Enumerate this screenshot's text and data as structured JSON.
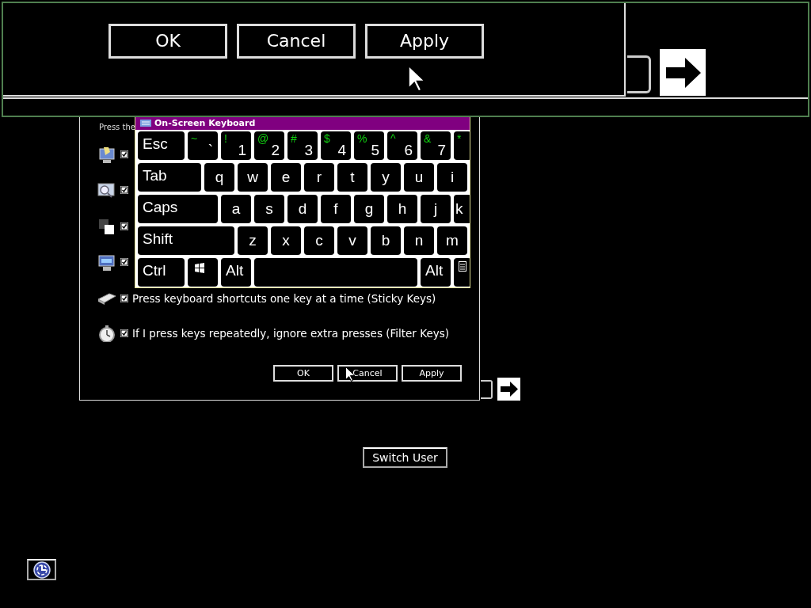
{
  "dialog": {
    "intro": "Press the",
    "options": [
      {
        "checked": true
      },
      {
        "checked": true
      },
      {
        "checked": true
      },
      {
        "checked": true
      },
      {
        "checked": true,
        "label": "Press keyboard shortcuts one key at a time (Sticky Keys)"
      },
      {
        "checked": true,
        "label": "If I press keys repeatedly, ignore extra presses (Filter Keys)"
      }
    ],
    "buttons": [
      "OK",
      "Cancel",
      "Apply"
    ]
  },
  "keyboard": {
    "title": "On-Screen Keyboard",
    "key_rows": [
      {
        "keys": [
          {
            "kind": "esc",
            "label": "Esc"
          },
          {
            "kind": "char",
            "shift": "~",
            "label": "`"
          },
          {
            "kind": "char",
            "shift": "!",
            "label": "1"
          },
          {
            "kind": "char",
            "shift": "@",
            "label": "2"
          },
          {
            "kind": "char",
            "shift": "#",
            "label": "3"
          },
          {
            "kind": "char",
            "shift": "$",
            "label": "4"
          },
          {
            "kind": "char",
            "shift": "%",
            "label": "5"
          },
          {
            "kind": "char",
            "shift": "^",
            "label": "6"
          },
          {
            "kind": "char",
            "shift": "&",
            "label": "7"
          },
          {
            "kind": "cut",
            "shift": "*"
          }
        ]
      },
      {
        "keys": [
          {
            "kind": "tab",
            "label": "Tab"
          },
          {
            "kind": "char",
            "label": "q"
          },
          {
            "kind": "char",
            "label": "w"
          },
          {
            "kind": "char",
            "label": "e"
          },
          {
            "kind": "char",
            "label": "r"
          },
          {
            "kind": "char",
            "label": "t"
          },
          {
            "kind": "char",
            "label": "y"
          },
          {
            "kind": "char",
            "label": "u"
          },
          {
            "kind": "char",
            "label": "i"
          }
        ]
      },
      {
        "keys": [
          {
            "kind": "caps",
            "label": "Caps"
          },
          {
            "kind": "char",
            "label": "a"
          },
          {
            "kind": "char",
            "label": "s"
          },
          {
            "kind": "char",
            "label": "d"
          },
          {
            "kind": "char",
            "label": "f"
          },
          {
            "kind": "char",
            "label": "g"
          },
          {
            "kind": "char",
            "label": "h"
          },
          {
            "kind": "char",
            "label": "j"
          },
          {
            "kind": "cut",
            "label": "k"
          }
        ]
      },
      {
        "keys": [
          {
            "kind": "shift",
            "label": "Shift"
          },
          {
            "kind": "char",
            "label": "z"
          },
          {
            "kind": "char",
            "label": "x"
          },
          {
            "kind": "char",
            "label": "c"
          },
          {
            "kind": "char",
            "label": "v"
          },
          {
            "kind": "char",
            "label": "b"
          },
          {
            "kind": "char",
            "label": "n"
          },
          {
            "kind": "char",
            "label": "m"
          }
        ]
      },
      {
        "keys": [
          {
            "kind": "ctrl",
            "label": "Ctrl"
          },
          {
            "kind": "win"
          },
          {
            "kind": "char",
            "label": "Alt"
          },
          {
            "kind": "space"
          },
          {
            "kind": "char",
            "label": "Alt"
          },
          {
            "kind": "menu"
          }
        ]
      }
    ]
  },
  "magnifier": {
    "buttons": [
      "OK",
      "Cancel",
      "Apply"
    ]
  },
  "switch_user": "Switch User"
}
